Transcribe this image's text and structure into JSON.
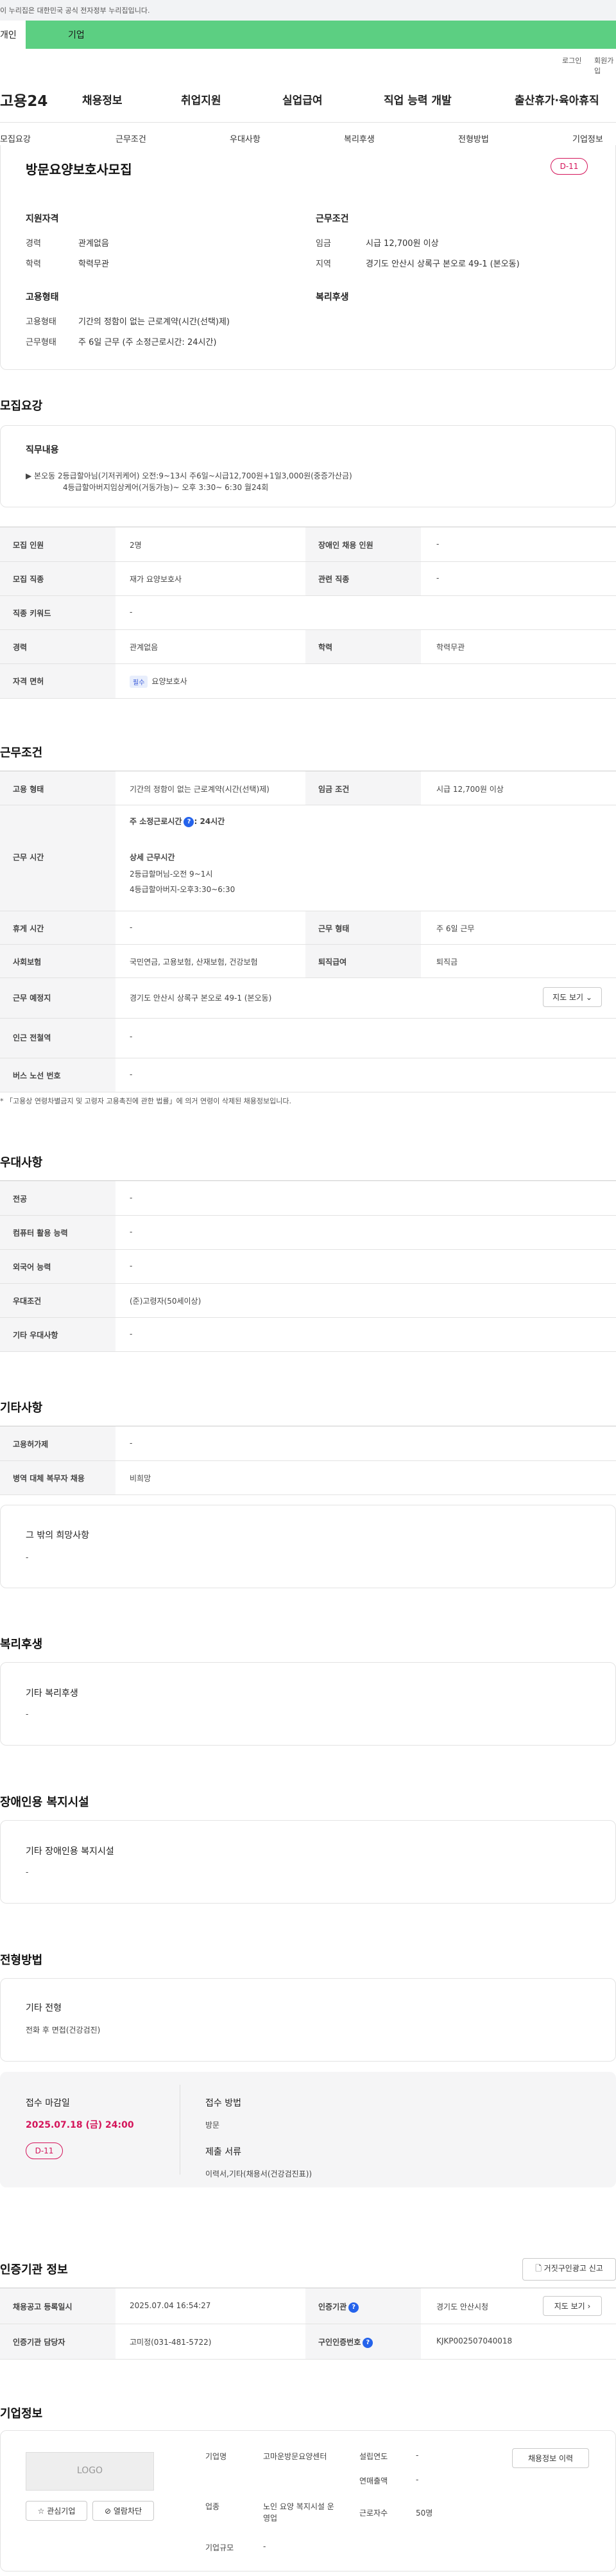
{
  "gov_banner": "이 누리집은 대한민국 공식 전자정부 누리집입니다.",
  "tabs": {
    "individual": "개인",
    "corporate": "기업"
  },
  "util": {
    "login": "로그인",
    "join": "회원가입"
  },
  "logo": "고용24",
  "gnb": [
    "채용정보",
    "취업지원",
    "실업급여",
    "직업 능력 개발",
    "출산휴가·육아휴직"
  ],
  "snb": [
    "모집요강",
    "근무조건",
    "우대사항",
    "복리후생",
    "전형방법",
    "기업정보"
  ],
  "summary": {
    "title": "방문요양보호사모집",
    "dday": "D-11",
    "qual_title": "지원자격",
    "career_label": "경력",
    "career": "관계없음",
    "edu_label": "학력",
    "edu": "학력무관",
    "cond_title": "근무조건",
    "wage_label": "임금",
    "wage": "시급 12,700원 이상",
    "loc_label": "지역",
    "loc": "경기도 안산시 상록구 본오로 49-1 (본오동)",
    "emp_title": "고용형태",
    "emp_type_label": "고용형태",
    "emp_type": "기간의 정함이 없는 근로계약(시간(선택)제)",
    "work_label": "근무형태",
    "work": "주 6일 근무 (주 소정근로시간: 24시간)",
    "welfare_title": "복리후생"
  },
  "recruit": {
    "heading": "모집요강",
    "duty_title": "직무내용",
    "duty_1": "▶ 본오동 2등급할아님(기저귀케어) 오전:9~13시 주6일~시급12,700원+1일3,000원(중증가산금)",
    "duty_2": "4등급할아버지임상케어(거동가능)~ 오후 3:30~ 6:30 월24회",
    "rows": [
      {
        "l1": "모집 인원",
        "v1": "2명",
        "l2": "장애인 채용 인원",
        "v2": "-"
      },
      {
        "l1": "모집 직종",
        "v1": "재가 요양보호사",
        "l2": "관련 직종",
        "v2": "-"
      },
      {
        "l1": "직종 키워드",
        "v1": "-"
      },
      {
        "l1": "경력",
        "v1": "관계없음",
        "l2": "학력",
        "v2": "학력무관"
      }
    ],
    "license_label": "자격 면허",
    "license_tag": "필수",
    "license": "요양보호사"
  },
  "cond": {
    "heading": "근무조건",
    "r1": {
      "l1": "고용 형태",
      "v1": "기간의 정함이 없는 근로계약(시간(선택)제)",
      "l2": "임금 조건",
      "v2": "시급 12,700원 이상"
    },
    "time_label": "근무 시간",
    "time_hours": "주 소정근로시간",
    "time_hours_val": ": 24시간",
    "time_detail_title": "상세 근무시간",
    "time_d1": "2등급할머님-오전 9~1시",
    "time_d2": "4등급할아버지-오후3:30~6:30",
    "r3": {
      "l1": "휴게 시간",
      "v1": "-",
      "l2": "근무 형태",
      "v2": "주 6일 근무"
    },
    "r4": {
      "l1": "사회보험",
      "v1": "국민연금, 고용보험, 산재보험, 건강보험",
      "l2": "퇴직급여",
      "v2": "퇴직금"
    },
    "place_label": "근무 예정지",
    "place": "경기도 안산시 상록구 본오로 49-1 (본오동)",
    "map_btn": "지도 보기",
    "subway_label": "인근 전철역",
    "subway": "-",
    "bus_label": "버스 노선 번호",
    "bus": "-",
    "note": "* 「고용상 연령차별금지 및 고령자 고용촉진에 관한 법률」에 의거 연령이 삭제된 채용정보입니다."
  },
  "pref": {
    "heading": "우대사항",
    "rows": [
      {
        "l": "전공",
        "v": "-"
      },
      {
        "l": "컴퓨터 활용 능력",
        "v": "-"
      },
      {
        "l": "외국어 능력",
        "v": "-"
      },
      {
        "l": "우대조건",
        "v": "(준)고령자(50세이상)"
      },
      {
        "l": "기타 우대사항",
        "v": "-"
      }
    ]
  },
  "etc": {
    "heading": "기타사항",
    "rows": [
      {
        "l": "고용허가제",
        "v": "-"
      },
      {
        "l": "병역 대체 복무자 채용",
        "v": "비희망"
      }
    ],
    "hope_title": "그 밖의 희망사항",
    "hope": "-"
  },
  "welfare": {
    "heading": "복리후생",
    "title": "기타 복리후생",
    "val": "-"
  },
  "disabled": {
    "heading": "장애인용 복지시설",
    "title": "기타 장애인용 복지시설",
    "val": "-"
  },
  "screen": {
    "heading": "전형방법",
    "etc_title": "기타 전형",
    "etc_val": "전화 후 면접(건강검진)",
    "deadline_title": "접수 마감일",
    "deadline": "2025.07.18 (금) 24:00",
    "dday": "D-11",
    "method_title": "접수 방법",
    "method": "방문",
    "docs_title": "제출 서류",
    "docs": "이력서,기타(채용서(건강검진표))"
  },
  "cert": {
    "heading": "인증기관 정보",
    "report_btn": "거짓구인광고 신고",
    "r1": {
      "l1": "채용공고 등록일시",
      "v1": "2025.07.04 16:54:27",
      "l2": "인증기관",
      "v2": "경기도 안산시청",
      "btn": "지도 보기"
    },
    "r2": {
      "l1": "인증기관 담당자",
      "v1": "고미정(031-481-5722)",
      "l2": "구인인증번호",
      "v2": "KJKP002507040018"
    }
  },
  "company": {
    "heading": "기업정보",
    "logo": "LOGO",
    "fav_btn": "관심기업",
    "block_btn": "열람차단",
    "name_label": "기업명",
    "name": "고마운방문요양센터",
    "found_label": "설립연도",
    "found": "-",
    "sales_label": "연매출액",
    "sales": "-",
    "industry_label": "업종",
    "industry": "노인 요양 복지시설 운영업",
    "emp_label": "근로자수",
    "emp": "50명",
    "size_label": "기업규모",
    "size": "-",
    "jobs_btn": "채용정보 이력"
  }
}
